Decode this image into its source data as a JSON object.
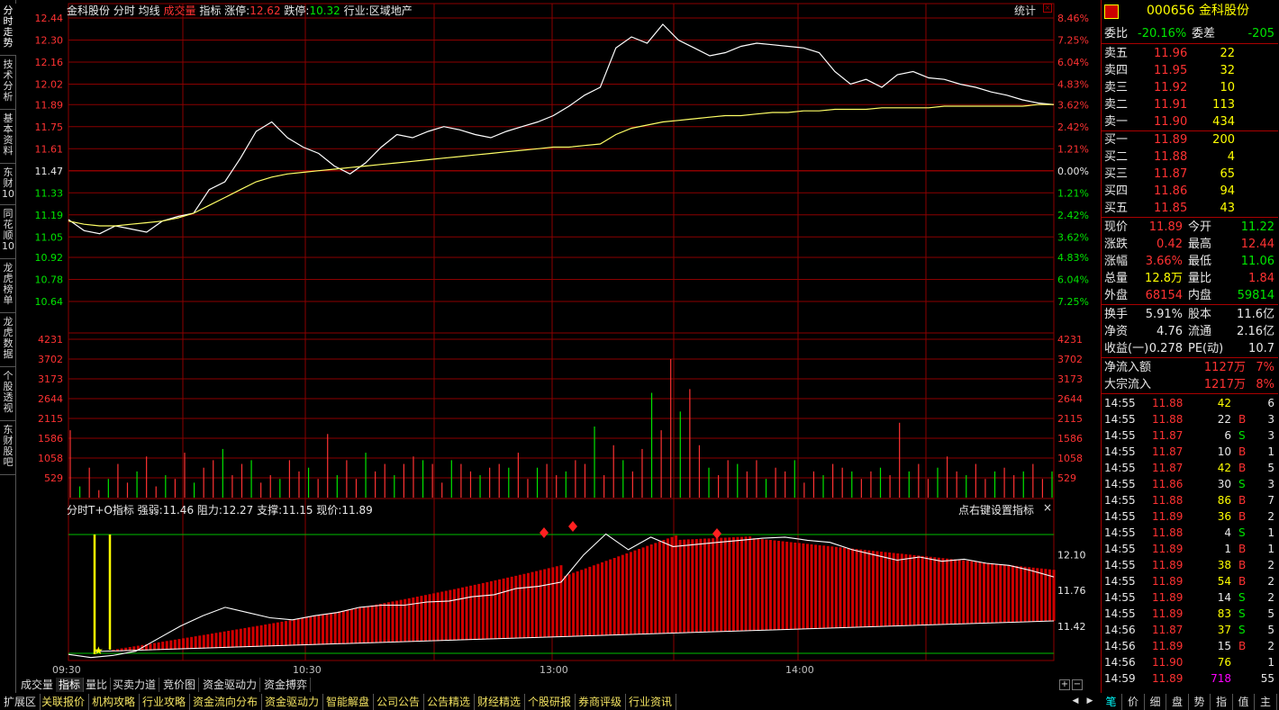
{
  "left_tabs": [
    "分\n时\n走\n势",
    "技\n术\n分\n析",
    "基\n本\n资\n料",
    "东\n财\n10",
    "同\n花\n顺\n10",
    "龙\n虎\n榜\n单",
    "龙\n虎\n数\n据",
    "个\n股\n透\n视",
    "东\n财\n股\n吧"
  ],
  "header": {
    "stock_name": "金科股份",
    "items": [
      {
        "text": "分时",
        "color": "#e8e8e8"
      },
      {
        "text": "均线",
        "color": "#e8e8e8"
      },
      {
        "text": "成交量",
        "color": "#ff3232"
      },
      {
        "text": "指标",
        "color": "#e8e8e8"
      }
    ],
    "limit_up_label": "涨停:",
    "limit_up": "12.62",
    "limit_down_label": "跌停:",
    "limit_down": "10.32",
    "industry_label": "行业:",
    "industry": "区域地产",
    "stats_button": "统计"
  },
  "indicator_header": {
    "name": "分时T+O指标",
    "strong_weak_label": "强弱:",
    "strong_weak": "11.46",
    "resistance_label": "阻力:",
    "resistance": "12.27",
    "support_label": "支撑:",
    "support": "11.15",
    "price_label": "现价:",
    "price": "11.89",
    "settings_hint": "点右键设置指标"
  },
  "chart_data": [
    {
      "type": "line",
      "panel": "price",
      "prev_close": 11.47,
      "ylim": [
        10.52,
        12.44
      ],
      "price_ticks": [
        "12.44",
        "12.30",
        "12.16",
        "12.02",
        "11.89",
        "11.75",
        "11.61",
        "11.47",
        "11.33",
        "11.19",
        "11.05",
        "10.92",
        "10.78",
        "10.64"
      ],
      "pct_ticks": [
        "8.46%",
        "7.25%",
        "6.04%",
        "4.83%",
        "3.62%",
        "2.42%",
        "1.21%",
        "0.00%",
        "1.21%",
        "2.42%",
        "3.62%",
        "4.83%",
        "6.04%",
        "7.25%"
      ],
      "x_ticks": [
        "09:30",
        "10:30",
        "13:00",
        "14:00"
      ],
      "series": [
        {
          "values": [
            11.16,
            11.09,
            11.07,
            11.12,
            11.1,
            11.08,
            11.15,
            11.18,
            11.2,
            11.35,
            11.4,
            11.55,
            11.72,
            11.78,
            11.68,
            11.62,
            11.58,
            11.5,
            11.45,
            11.52,
            11.62,
            11.7,
            11.68,
            11.72,
            11.75,
            11.73,
            11.7,
            11.68,
            11.72,
            11.75,
            11.78,
            11.82,
            11.88,
            11.95,
            12.0,
            12.25,
            12.32,
            12.28,
            12.4,
            12.3,
            12.25,
            12.2,
            12.22,
            12.26,
            12.28,
            12.27,
            12.26,
            12.25,
            12.22,
            12.1,
            12.02,
            12.05,
            12.0,
            12.08,
            12.1,
            12.06,
            12.05,
            12.02,
            12.0,
            11.97,
            11.95,
            11.92,
            11.9,
            11.89
          ]
        },
        {
          "values": [
            11.15,
            11.13,
            11.12,
            11.12,
            11.13,
            11.14,
            11.15,
            11.17,
            11.2,
            11.25,
            11.3,
            11.35,
            11.4,
            11.43,
            11.45,
            11.46,
            11.47,
            11.48,
            11.49,
            11.5,
            11.51,
            11.52,
            11.53,
            11.54,
            11.55,
            11.56,
            11.57,
            11.58,
            11.59,
            11.6,
            11.61,
            11.62,
            11.62,
            11.63,
            11.64,
            11.7,
            11.74,
            11.76,
            11.78,
            11.79,
            11.8,
            11.81,
            11.82,
            11.82,
            11.83,
            11.84,
            11.84,
            11.85,
            11.85,
            11.86,
            11.86,
            11.86,
            11.87,
            11.87,
            11.87,
            11.87,
            11.88,
            11.88,
            11.88,
            11.88,
            11.88,
            11.88,
            11.89,
            11.89
          ]
        }
      ]
    },
    {
      "type": "bar",
      "panel": "volume",
      "ylim": [
        0,
        4231
      ],
      "volume_ticks": [
        "4231",
        "3702",
        "3173",
        "2644",
        "2115",
        "1586",
        "1058",
        "529"
      ],
      "values": [
        1800,
        300,
        800,
        200,
        500,
        900,
        400,
        700,
        1100,
        300,
        600,
        500,
        1200,
        400,
        800,
        1000,
        1300,
        600,
        900,
        1000,
        400,
        600,
        500,
        1000,
        700,
        800,
        500,
        1700,
        600,
        1000,
        500,
        1200,
        700,
        900,
        600,
        900,
        1100,
        1000,
        900,
        400,
        1000,
        900,
        700,
        600,
        800,
        900,
        800,
        1200,
        500,
        800,
        900,
        600,
        700,
        1000,
        900,
        1900,
        600,
        1400,
        1000,
        700,
        1300,
        2800,
        1800,
        3700,
        2300,
        2900,
        1400,
        800,
        600,
        1000,
        900,
        700,
        1000,
        500,
        800,
        700,
        1000,
        400,
        700,
        600,
        900,
        800,
        700,
        500,
        700,
        800,
        600,
        2000,
        700,
        900,
        500,
        800,
        1100,
        700,
        600,
        900,
        500,
        700,
        800,
        600,
        700,
        900,
        500,
        700
      ]
    },
    {
      "type": "line",
      "panel": "indicator",
      "ylim": [
        11.1,
        12.45
      ],
      "indicator_ticks": [
        "12.10",
        "11.76",
        "11.42"
      ],
      "series": [
        {
          "values": [
            11.15,
            11.12,
            11.14,
            11.18,
            11.3,
            11.42,
            11.52,
            11.6,
            11.55,
            11.5,
            11.48,
            11.52,
            11.55,
            11.6,
            11.62,
            11.62,
            11.65,
            11.66,
            11.7,
            11.72,
            11.78,
            11.8,
            11.84,
            12.1,
            12.3,
            12.15,
            12.27,
            12.18,
            12.2,
            12.22,
            12.24,
            12.26,
            12.27,
            12.24,
            12.22,
            12.15,
            12.1,
            12.05,
            12.08,
            12.04,
            12.06,
            12.02,
            12.0,
            11.95,
            11.89
          ]
        }
      ]
    }
  ],
  "bottom_tabs": [
    "成交量",
    "指标",
    "量比",
    "买卖力道",
    "竞价图",
    "资金驱动力",
    "资金搏弈"
  ],
  "global_tabs": [
    "扩展区",
    "关联报价",
    "机构攻略",
    "行业攻略",
    "资金流向分布",
    "资金驱动力",
    "智能解盘",
    "公司公告",
    "公告精选",
    "财经精选",
    "个股研报",
    "券商评级",
    "行业资讯"
  ],
  "right_panel": {
    "code": "000656",
    "name": "金科股份",
    "ratio_label": "委比",
    "ratio": "-20.16%",
    "diff_label": "委差",
    "diff": "-205",
    "asks": [
      {
        "label": "卖五",
        "price": "11.96",
        "vol": "22"
      },
      {
        "label": "卖四",
        "price": "11.95",
        "vol": "32"
      },
      {
        "label": "卖三",
        "price": "11.92",
        "vol": "10"
      },
      {
        "label": "卖二",
        "price": "11.91",
        "vol": "113"
      },
      {
        "label": "卖一",
        "price": "11.90",
        "vol": "434"
      }
    ],
    "bids": [
      {
        "label": "买一",
        "price": "11.89",
        "vol": "200"
      },
      {
        "label": "买二",
        "price": "11.88",
        "vol": "4"
      },
      {
        "label": "买三",
        "price": "11.87",
        "vol": "65"
      },
      {
        "label": "买四",
        "price": "11.86",
        "vol": "94"
      },
      {
        "label": "买五",
        "price": "11.85",
        "vol": "43"
      }
    ],
    "quote": [
      {
        "l1": "现价",
        "v1": "11.89",
        "c1": "red",
        "l2": "今开",
        "v2": "11.22",
        "c2": "green"
      },
      {
        "l1": "涨跌",
        "v1": "0.42",
        "c1": "red",
        "l2": "最高",
        "v2": "12.44",
        "c2": "red"
      },
      {
        "l1": "涨幅",
        "v1": "3.66%",
        "c1": "red",
        "l2": "最低",
        "v2": "11.06",
        "c2": "green"
      },
      {
        "l1": "总量",
        "v1": "12.8万",
        "c1": "yellow",
        "l2": "量比",
        "v2": "1.84",
        "c2": "red"
      },
      {
        "l1": "外盘",
        "v1": "68154",
        "c1": "red",
        "l2": "内盘",
        "v2": "59814",
        "c2": "green"
      }
    ],
    "fundamentals": [
      {
        "l1": "换手",
        "v1": "5.91%",
        "l2": "股本",
        "v2": "11.6亿"
      },
      {
        "l1": "净资",
        "v1": "4.76",
        "l2": "流通",
        "v2": "2.16亿"
      },
      {
        "l1": "收益(一)",
        "v1": "0.278",
        "l2": "PE(动)",
        "v2": "10.7"
      }
    ],
    "flows": [
      {
        "label": "净流入额",
        "value": "1127万",
        "pct": "7%"
      },
      {
        "label": "大宗流入",
        "value": "1217万",
        "pct": "8%"
      }
    ],
    "ticks": [
      {
        "t": "14:55",
        "p": "11.88",
        "v": "42",
        "d": "",
        "n": "6",
        "pc": "red",
        "vc": "yellow"
      },
      {
        "t": "14:55",
        "p": "11.88",
        "v": "22",
        "d": "B",
        "n": "3",
        "pc": "red",
        "vc": "white"
      },
      {
        "t": "14:55",
        "p": "11.87",
        "v": "6",
        "d": "S",
        "n": "3",
        "pc": "red",
        "vc": "white"
      },
      {
        "t": "14:55",
        "p": "11.87",
        "v": "10",
        "d": "B",
        "n": "1",
        "pc": "red",
        "vc": "white"
      },
      {
        "t": "14:55",
        "p": "11.87",
        "v": "42",
        "d": "B",
        "n": "5",
        "pc": "red",
        "vc": "yellow"
      },
      {
        "t": "14:55",
        "p": "11.86",
        "v": "30",
        "d": "S",
        "n": "3",
        "pc": "red",
        "vc": "white"
      },
      {
        "t": "14:55",
        "p": "11.88",
        "v": "86",
        "d": "B",
        "n": "7",
        "pc": "red",
        "vc": "yellow"
      },
      {
        "t": "14:55",
        "p": "11.89",
        "v": "36",
        "d": "B",
        "n": "2",
        "pc": "red",
        "vc": "yellow"
      },
      {
        "t": "14:55",
        "p": "11.88",
        "v": "4",
        "d": "S",
        "n": "1",
        "pc": "red",
        "vc": "white"
      },
      {
        "t": "14:55",
        "p": "11.89",
        "v": "1",
        "d": "B",
        "n": "1",
        "pc": "red",
        "vc": "white"
      },
      {
        "t": "14:55",
        "p": "11.89",
        "v": "38",
        "d": "B",
        "n": "2",
        "pc": "red",
        "vc": "yellow"
      },
      {
        "t": "14:55",
        "p": "11.89",
        "v": "54",
        "d": "B",
        "n": "2",
        "pc": "red",
        "vc": "yellow"
      },
      {
        "t": "14:55",
        "p": "11.89",
        "v": "14",
        "d": "S",
        "n": "2",
        "pc": "red",
        "vc": "white"
      },
      {
        "t": "14:55",
        "p": "11.89",
        "v": "83",
        "d": "S",
        "n": "5",
        "pc": "red",
        "vc": "yellow"
      },
      {
        "t": "14:56",
        "p": "11.87",
        "v": "37",
        "d": "S",
        "n": "5",
        "pc": "red",
        "vc": "yellow"
      },
      {
        "t": "14:56",
        "p": "11.89",
        "v": "15",
        "d": "B",
        "n": "2",
        "pc": "red",
        "vc": "white"
      },
      {
        "t": "14:56",
        "p": "11.90",
        "v": "76",
        "d": "",
        "n": "1",
        "pc": "red",
        "vc": "yellow"
      },
      {
        "t": "14:59",
        "p": "11.89",
        "v": "718",
        "d": "",
        "n": "55",
        "pc": "red",
        "vc": "magenta"
      }
    ],
    "bottom_tabs": [
      "笔",
      "价",
      "细",
      "盘",
      "势",
      "指",
      "值",
      "主"
    ]
  }
}
